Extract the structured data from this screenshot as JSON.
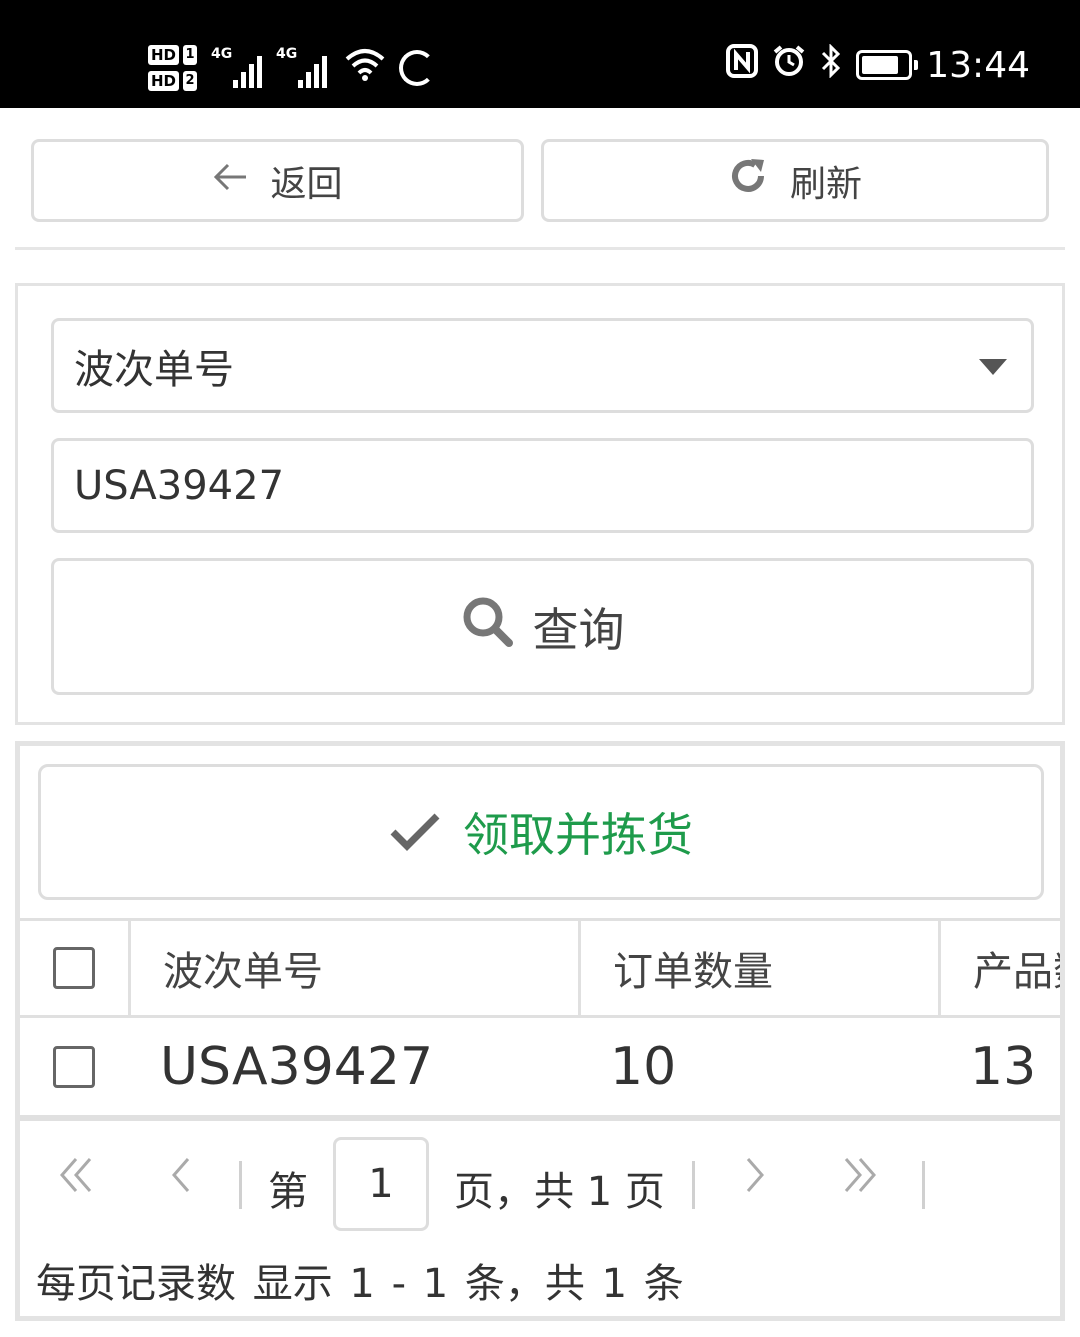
{
  "status_bar": {
    "hd1": "HD",
    "hd1_num": "1",
    "hd2": "HD",
    "hd2_num": "2",
    "sig1_label": "4G",
    "sig2_label": "4G",
    "time": "13:44"
  },
  "toolbar": {
    "back_label": "返回",
    "refresh_label": "刷新"
  },
  "search": {
    "type_select_value": "波次单号",
    "input_value": "USA39427",
    "query_label": "查询"
  },
  "grid": {
    "pick_button_label": "领取并拣货",
    "columns": [
      "波次单号",
      "订单数量",
      "产品数"
    ],
    "rows": [
      {
        "wave_no": "USA39427",
        "order_qty": "10",
        "product_qty": "13"
      }
    ],
    "pager": {
      "page_prefix": "第",
      "current_page": "1",
      "page_suffix": "页，共 1 页",
      "per_page_label": "每页记录数",
      "display_info": "显示 1 - 1 条，共 1 条"
    }
  },
  "colors": {
    "accent_green": "#1e9b4b",
    "border": "#dddddd"
  }
}
